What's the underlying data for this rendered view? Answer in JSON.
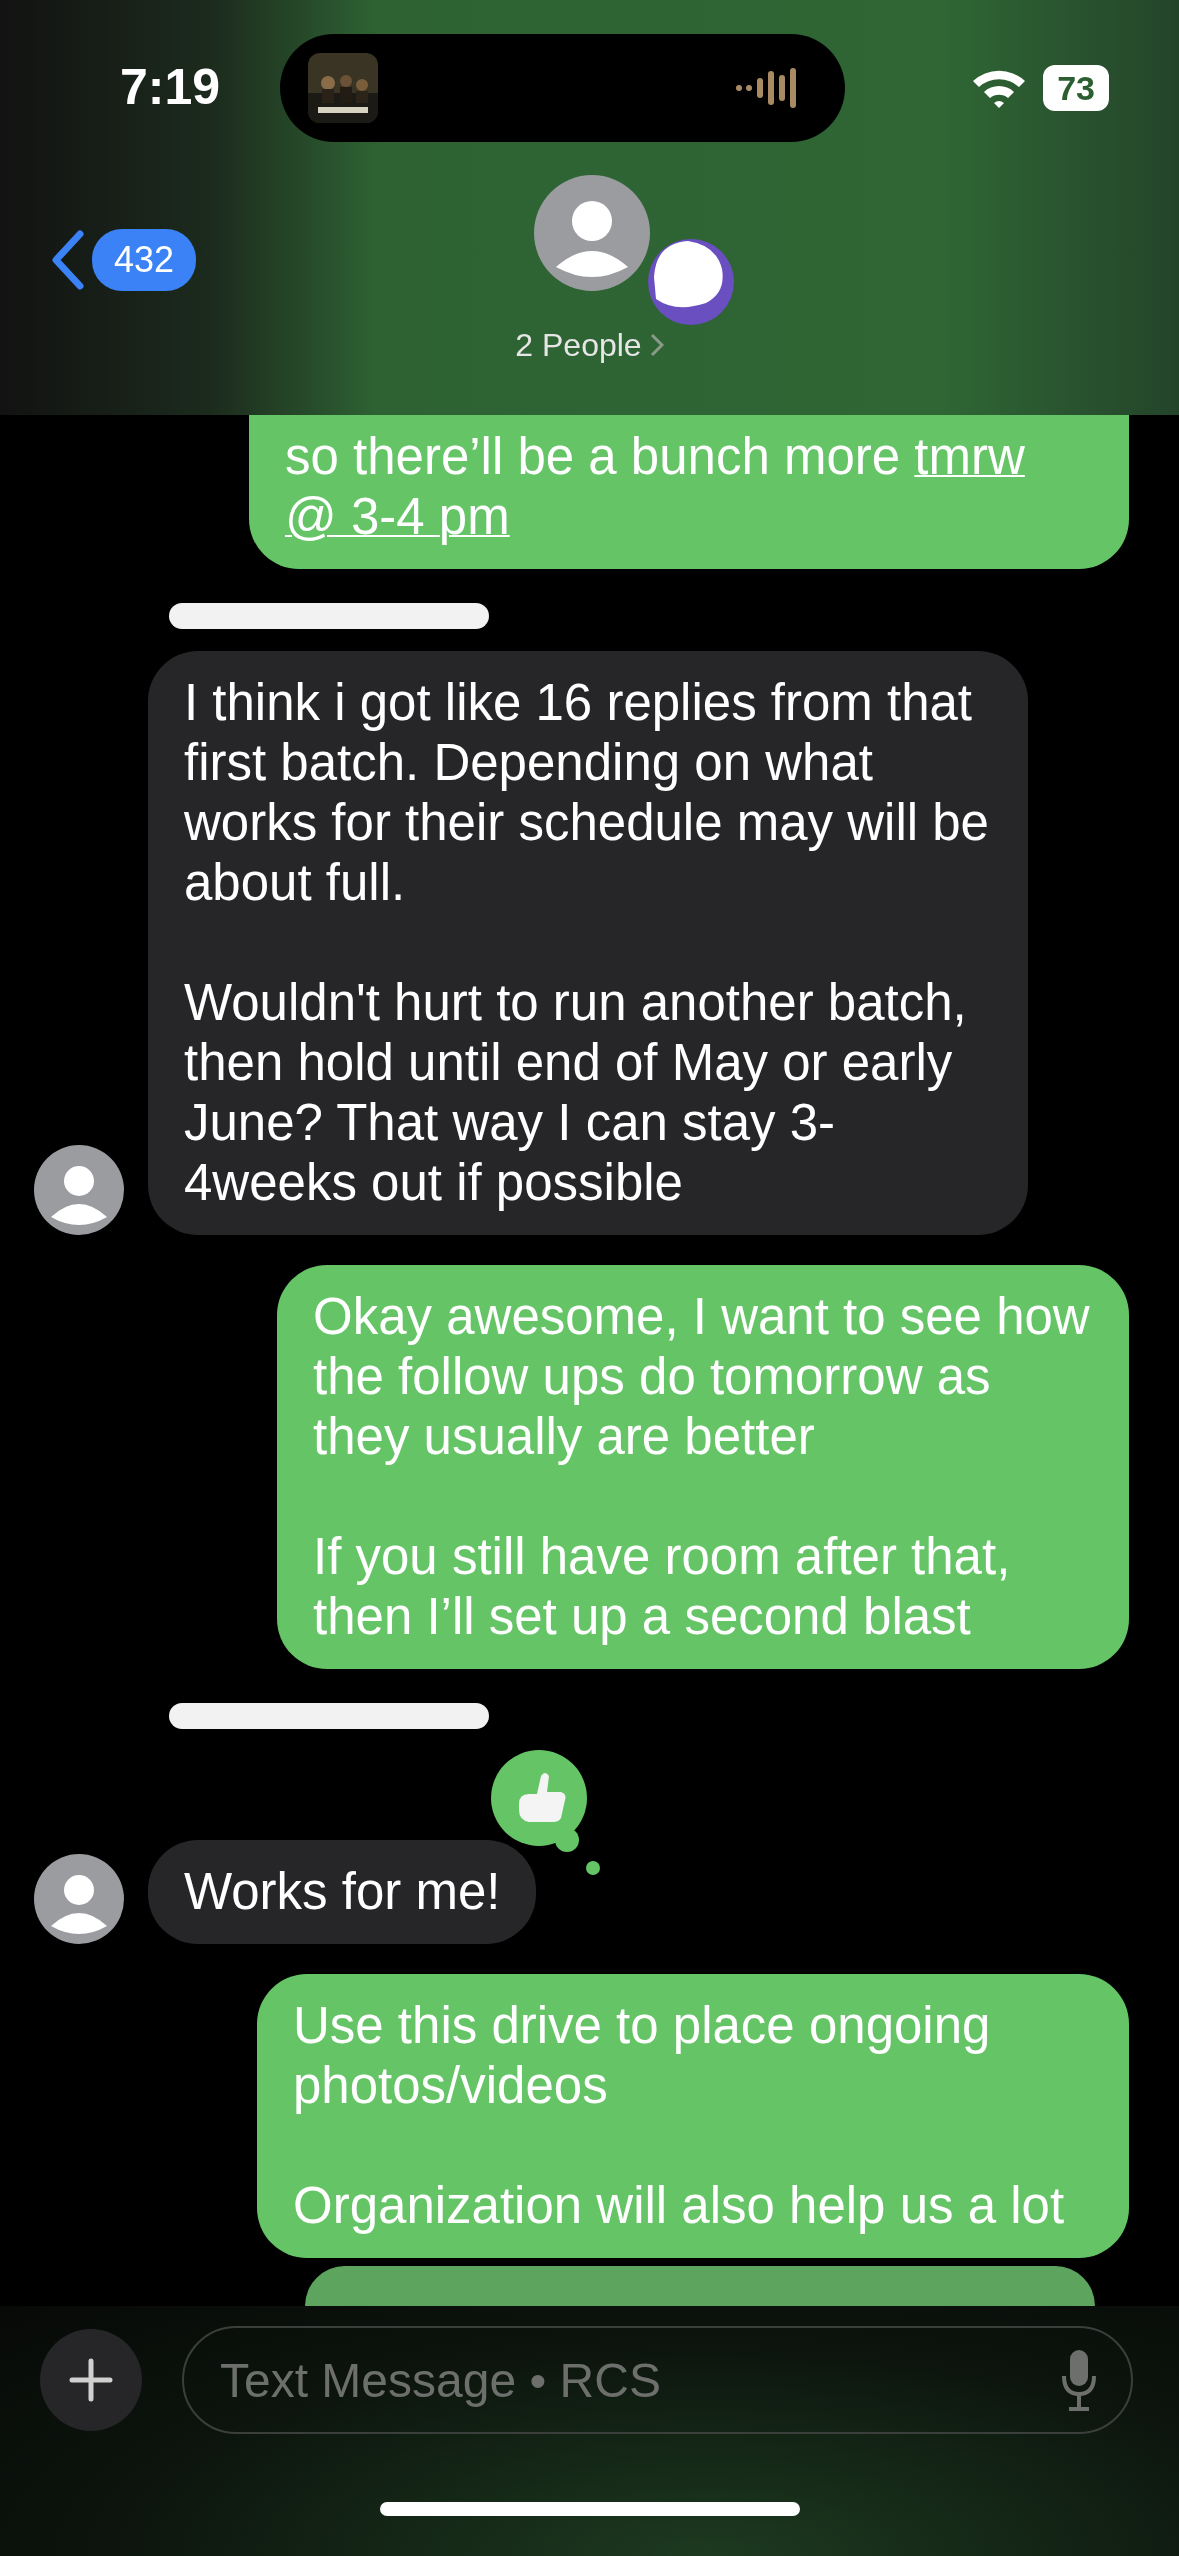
{
  "status_bar": {
    "time": "7:19",
    "battery": "73"
  },
  "header": {
    "back_count": "432",
    "title": "2 People"
  },
  "messages": [
    {
      "kind": "sent",
      "liked": false,
      "text": "so there’ll be a bunch more",
      "links": [
        "tmrw",
        "@ 3-4 pm"
      ]
    },
    {
      "kind": "received",
      "sender_redacted": true,
      "liked": false,
      "paragraphs": [
        "I think i got like 16 replies from that first batch.  Depending on what works for their schedule may will be about full.",
        "Wouldn't hurt to run another batch, then hold until end of May or early June? That way I can stay 3-4weeks out if possible"
      ]
    },
    {
      "kind": "sent",
      "liked": false,
      "paragraphs": [
        "Okay awesome, I want to see how the follow ups do tomorrow as they usually are better",
        "If you still have room after that, then I’ll set up a second blast"
      ]
    },
    {
      "kind": "received",
      "sender_redacted": true,
      "liked": true,
      "paragraphs": [
        "Works for me!"
      ]
    },
    {
      "kind": "sent",
      "liked": false,
      "paragraphs": [
        "Use this drive to place ongoing photos/videos",
        "Organization will also help us a lot"
      ]
    },
    {
      "kind": "partial"
    }
  ],
  "composer": {
    "placeholder": "Text Message • RCS"
  }
}
